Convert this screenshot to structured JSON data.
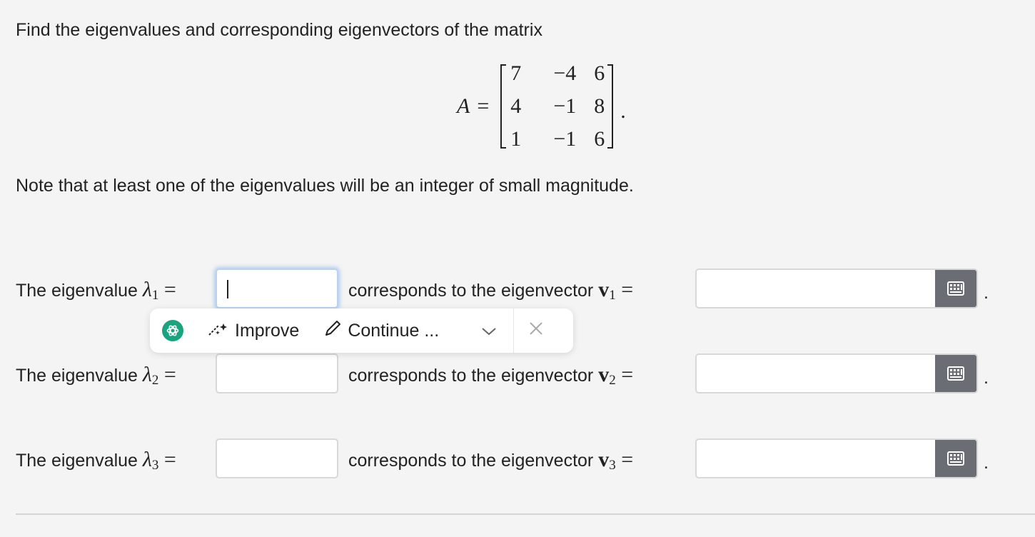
{
  "question": {
    "prompt": "Find the eigenvalues and corresponding eigenvectors of the matrix",
    "matrix_name": "A",
    "matrix_rows": [
      [
        "7",
        "−4",
        "6"
      ],
      [
        "4",
        "−1",
        "8"
      ],
      [
        "1",
        "−1",
        "6"
      ]
    ],
    "note": "Note that at least one of the eigenvalues will be an integer of small magnitude."
  },
  "answers": {
    "eigenvalue_prefix": "The eigenvalue",
    "lambda_symbol": "λ",
    "eigenvector_text": "corresponds to the eigenvector",
    "vector_symbol": "v",
    "rows": [
      {
        "index": "1",
        "eigenvalue": "",
        "eigenvector": "",
        "focused": true
      },
      {
        "index": "2",
        "eigenvalue": "",
        "eigenvector": "",
        "focused": false
      },
      {
        "index": "3",
        "eigenvalue": "",
        "eigenvector": "",
        "focused": false
      }
    ]
  },
  "popup": {
    "improve_label": "Improve",
    "continue_label": "Continue ...",
    "logo_icon": "chatgpt-logo-icon",
    "accent_color": "#19a37e"
  },
  "colors": {
    "background": "#f4f4f4",
    "keyboard_button": "#6a6d73",
    "focus_ring": "#b9d2f2"
  }
}
